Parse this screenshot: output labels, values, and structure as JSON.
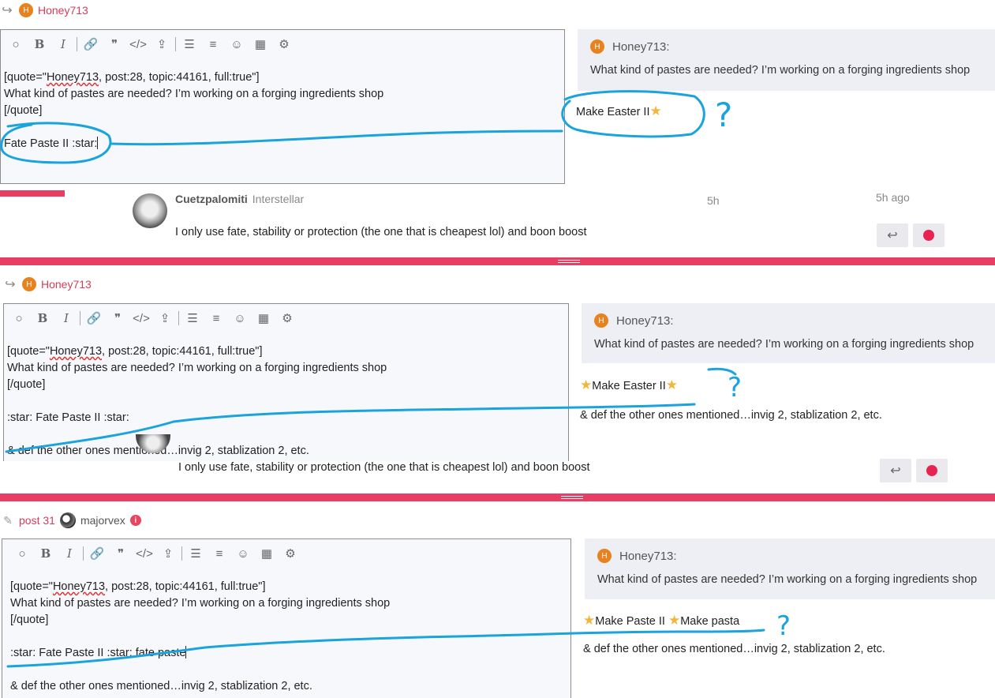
{
  "composer_panels": [
    {
      "reply_to_user": "Honey713",
      "editor_lines": [
        [
          "[quote=\"",
          "Honey713",
          ", post:28, topic:44161, full:true\"]"
        ],
        "What kind of pastes are needed? I’m working on a forging ingredients shop",
        "[/quote]",
        "",
        "Fate Paste II :star:"
      ],
      "preview": {
        "quote_user": "Honey713:",
        "quote_text": "What kind of pastes are needed? I’m working on a forging ingredients shop",
        "line1": "Make Easter II",
        "annotation": "?"
      },
      "below": {
        "name": "Cuetzpalomiti",
        "title": "Interstellar",
        "age": "5h",
        "ago": "5h ago",
        "text": "I only use fate, stability or protection (the one that is cheapest lol) and boon boost"
      }
    },
    {
      "reply_to_user": "Honey713",
      "editor_lines": [
        [
          "[quote=\"",
          "Honey713",
          ", post:28, topic:44161, full:true\"]"
        ],
        "What kind of pastes are needed? I’m working on a forging ingredients shop",
        "[/quote]",
        "",
        ":star: Fate Paste II :star:",
        "",
        "& def the other ones mentioned…invig 2, stablization 2, etc."
      ],
      "preview": {
        "quote_user": "Honey713:",
        "quote_text": "What kind of pastes are needed? I’m working on a forging ingredients shop",
        "line1": "Make Easter II",
        "line2": "& def the other ones mentioned…invig 2, stablization 2, etc.",
        "annotation": "?"
      },
      "below": {
        "text": "I only use fate, stability or protection (the one that is cheapest lol) and boon boost"
      }
    },
    {
      "edit_post_label": "post 31",
      "edit_user": "majorvex",
      "editor_lines": [
        [
          "[quote=\"",
          "Honey713",
          ", post:28, topic:44161, full:true\"]"
        ],
        "What kind of pastes are needed? I’m working on a forging ingredients shop",
        "[/quote]",
        "",
        ":star: Fate Paste II :star: fate paste",
        "",
        "& def the other ones mentioned…invig 2, stablization 2, etc."
      ],
      "preview": {
        "quote_user": "Honey713:",
        "quote_text": "What kind of pastes are needed? I’m working on a forging ingredients shop",
        "line1a": "Make Paste II",
        "line1b": "Make pasta",
        "line2": "& def the other ones mentioned…invig 2, stablization 2, etc.",
        "annotation": "?"
      }
    }
  ],
  "toolbar_icons": [
    "speech-bubble-icon",
    "bold-icon",
    "italic-icon",
    "link-icon",
    "blockquote-icon",
    "code-icon",
    "upload-icon",
    "bullet-list-icon",
    "numbered-list-icon",
    "emoji-icon",
    "calendar-icon",
    "gear-icon"
  ],
  "avatar_letter": "H",
  "colors": {
    "accent": "#e83e64",
    "annotation": "#1aa3dc",
    "avatar": "#e8821e"
  }
}
